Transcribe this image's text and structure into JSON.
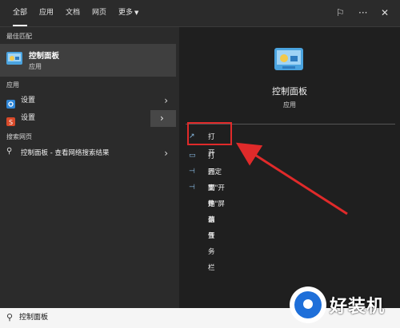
{
  "tabs": [
    "全部",
    "应用",
    "文档",
    "网页",
    "更多"
  ],
  "header_icons": [
    "feedback-icon",
    "more-icon",
    "close-icon"
  ],
  "sections": {
    "best_match": "最佳匹配",
    "apps": "应用",
    "web": "搜索网页"
  },
  "best_match": {
    "title": "控制面板",
    "subtitle": "应用"
  },
  "apps": [
    {
      "label": "设置"
    },
    {
      "label": "设置"
    }
  ],
  "web_result": {
    "label": "控制面板 - 查看网络搜索结果"
  },
  "detail": {
    "title": "控制面板",
    "subtitle": "应用",
    "actions": [
      {
        "label": "打开"
      },
      {
        "label": "打开文件位置"
      },
      {
        "label": "固定到\"开始\"屏幕"
      },
      {
        "label": "固定到任务栏"
      }
    ]
  },
  "search": {
    "value": "控制面板"
  },
  "watermark": "好装机",
  "colors": {
    "highlight": "#e02a2a",
    "accent": "#1e6fd9"
  }
}
